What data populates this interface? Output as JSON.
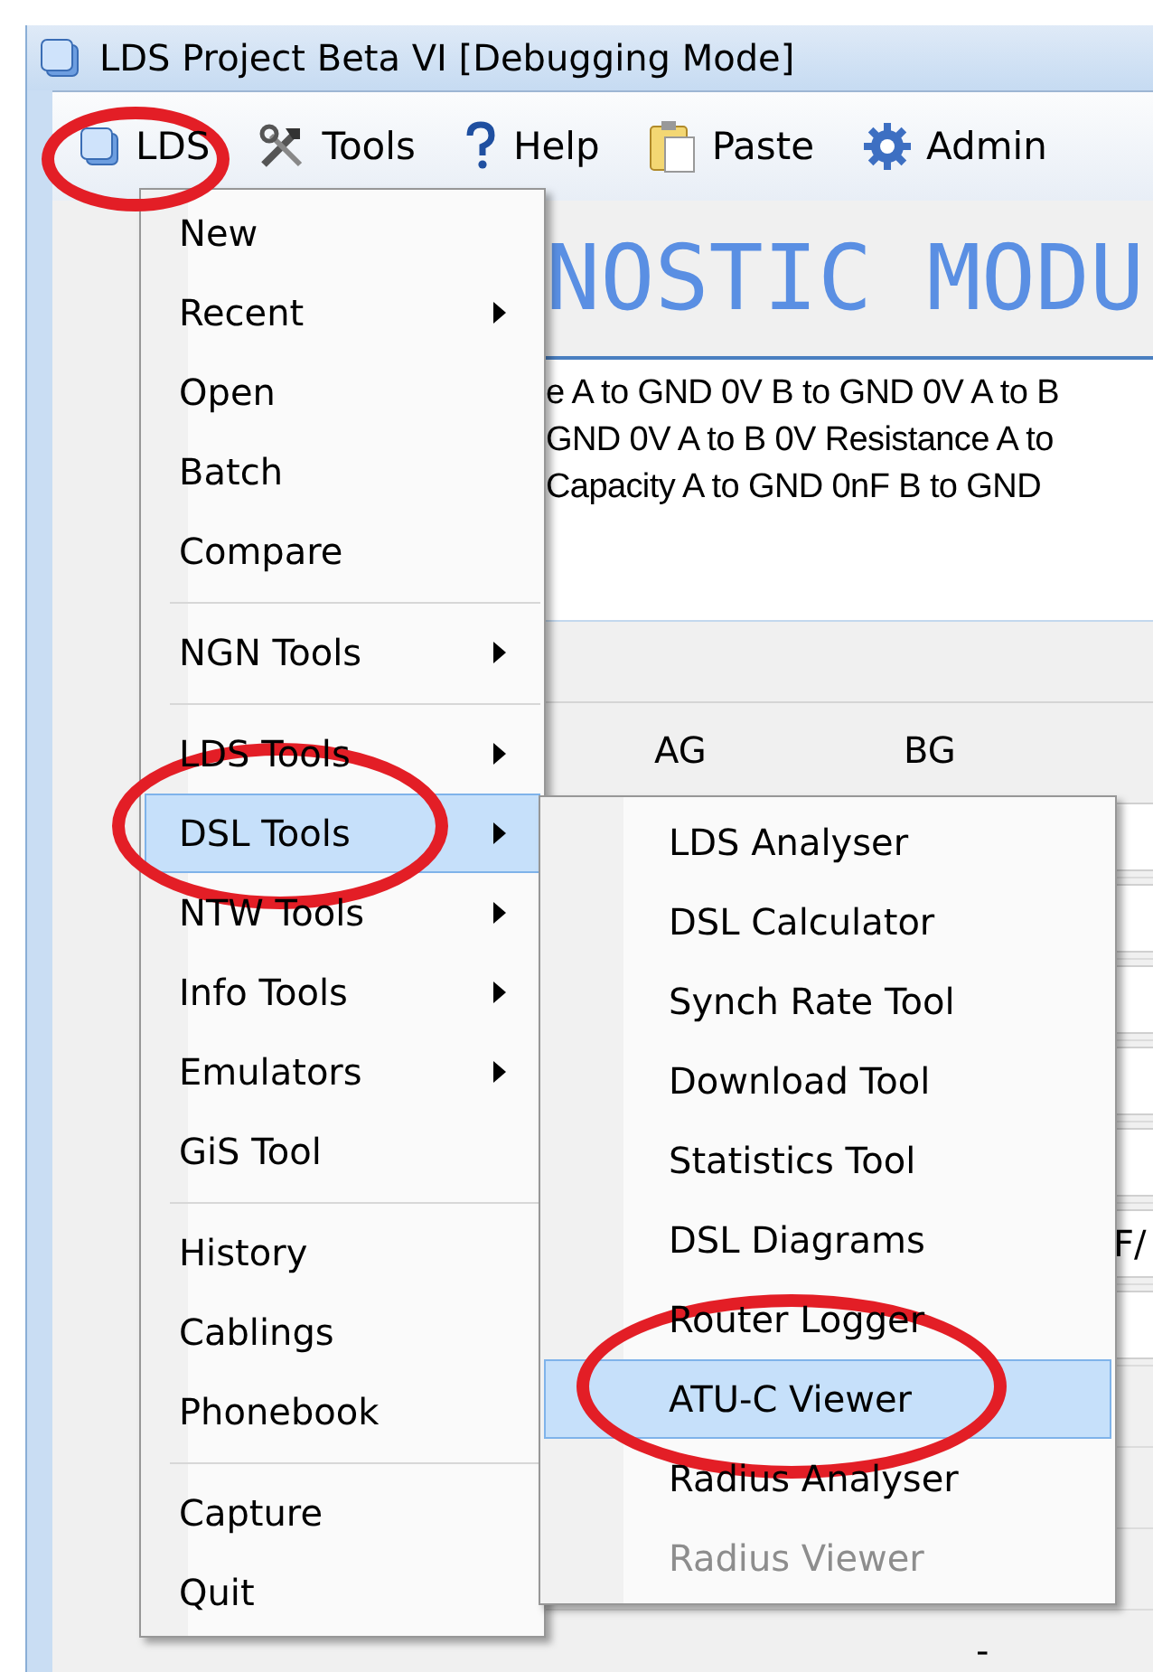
{
  "window": {
    "title": "LDS Project Beta VI [Debugging Mode]"
  },
  "menu_bar": [
    {
      "label": "LDS",
      "circled": true
    },
    {
      "label": "Tools",
      "circled": false
    },
    {
      "label": "Help",
      "circled": false
    },
    {
      "label": "Paste",
      "circled": false
    },
    {
      "label": "Admin",
      "circled": false
    }
  ],
  "background": {
    "banner": "NOSTIC MODU",
    "lines": [
      "e A to GND 0V B to GND 0V A to B",
      "GND 0V A to B 0V Resistance A to",
      "Capacity A to GND 0nF B to GND"
    ],
    "columns": [
      "AG",
      "BG"
    ],
    "side_cell": "F/",
    "last_value": "-"
  },
  "menu": [
    {
      "kind": "item",
      "label": "New",
      "submenu": false,
      "selected": false,
      "circled": false
    },
    {
      "kind": "item",
      "label": "Recent",
      "submenu": true,
      "selected": false,
      "circled": false
    },
    {
      "kind": "item",
      "label": "Open",
      "submenu": false,
      "selected": false,
      "circled": false
    },
    {
      "kind": "item",
      "label": "Batch",
      "submenu": false,
      "selected": false,
      "circled": false
    },
    {
      "kind": "item",
      "label": "Compare",
      "submenu": false,
      "selected": false,
      "circled": false
    },
    {
      "kind": "separator"
    },
    {
      "kind": "item",
      "label": "NGN Tools",
      "submenu": true,
      "selected": false,
      "circled": false
    },
    {
      "kind": "separator"
    },
    {
      "kind": "item",
      "label": "LDS Tools",
      "submenu": true,
      "selected": false,
      "circled": false
    },
    {
      "kind": "item",
      "label": "DSL Tools",
      "submenu": true,
      "selected": true,
      "circled": true
    },
    {
      "kind": "item",
      "label": "NTW Tools",
      "submenu": true,
      "selected": false,
      "circled": false
    },
    {
      "kind": "item",
      "label": "Info Tools",
      "submenu": true,
      "selected": false,
      "circled": false
    },
    {
      "kind": "item",
      "label": "Emulators",
      "submenu": true,
      "selected": false,
      "circled": false
    },
    {
      "kind": "item",
      "label": "GiS Tool",
      "submenu": false,
      "selected": false,
      "circled": false
    },
    {
      "kind": "separator"
    },
    {
      "kind": "item",
      "label": "History",
      "submenu": false,
      "selected": false,
      "circled": false
    },
    {
      "kind": "item",
      "label": "Cablings",
      "submenu": false,
      "selected": false,
      "circled": false
    },
    {
      "kind": "item",
      "label": "Phonebook",
      "submenu": false,
      "selected": false,
      "circled": false
    },
    {
      "kind": "separator"
    },
    {
      "kind": "item",
      "label": "Capture",
      "submenu": false,
      "selected": false,
      "circled": false
    },
    {
      "kind": "item",
      "label": "Quit",
      "submenu": false,
      "selected": false,
      "circled": false
    }
  ],
  "submenu": [
    {
      "label": "LDS Analyser",
      "selected": false,
      "disabled": false,
      "circled": false
    },
    {
      "label": "DSL Calculator",
      "selected": false,
      "disabled": false,
      "circled": false
    },
    {
      "label": "Synch Rate Tool",
      "selected": false,
      "disabled": false,
      "circled": false
    },
    {
      "label": "Download Tool",
      "selected": false,
      "disabled": false,
      "circled": false
    },
    {
      "label": "Statistics Tool",
      "selected": false,
      "disabled": false,
      "circled": false
    },
    {
      "label": "DSL Diagrams",
      "selected": false,
      "disabled": false,
      "circled": false
    },
    {
      "label": "Router Logger",
      "selected": false,
      "disabled": false,
      "circled": false
    },
    {
      "label": "ATU-C Viewer",
      "selected": true,
      "disabled": false,
      "circled": true
    },
    {
      "label": "Radius Analyser",
      "selected": false,
      "disabled": false,
      "circled": false
    },
    {
      "label": "Radius Viewer",
      "selected": false,
      "disabled": true,
      "circled": false
    }
  ]
}
